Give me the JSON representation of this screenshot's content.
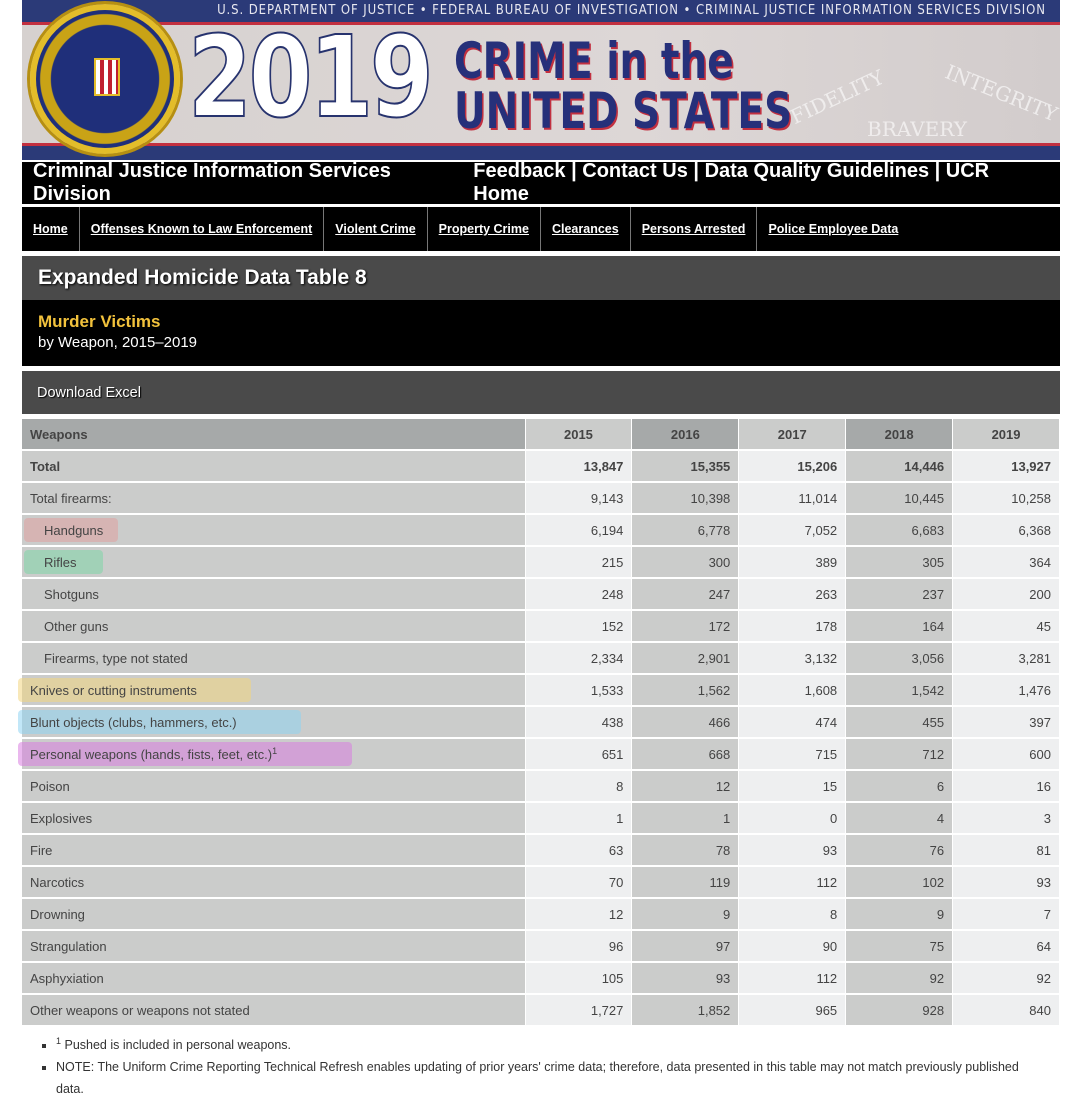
{
  "banner": {
    "topline": "U.S. DEPARTMENT OF JUSTICE • FEDERAL BUREAU OF INVESTIGATION • CRIMINAL JUSTICE INFORMATION SERVICES DIVISION",
    "year": "2019",
    "title_line1": "CRIME in the",
    "title_line2": "UNITED STATES",
    "motto": [
      "FIDELITY",
      "BRAVERY",
      "INTEGRITY"
    ]
  },
  "header": {
    "division": "Criminal Justice Information Services Division",
    "links": [
      "Feedback",
      "Contact Us",
      "Data Quality Guidelines",
      "UCR Home"
    ],
    "separator": " | "
  },
  "nav": [
    "Home",
    "Offenses Known to Law Enforcement",
    "Violent Crime",
    "Property Crime",
    "Clearances",
    "Persons Arrested",
    "Police Employee Data"
  ],
  "page": {
    "title": "Expanded Homicide Data Table 8",
    "subtitle": "Murder Victims",
    "subtitle2": "by Weapon, 2015–2019",
    "download": "Download Excel"
  },
  "table": {
    "headers": [
      "Weapons",
      "2015",
      "2016",
      "2017",
      "2018",
      "2019"
    ],
    "rows": [
      {
        "label": "Total",
        "values": [
          "13,847",
          "15,355",
          "15,206",
          "14,446",
          "13,927"
        ],
        "bold": true
      },
      {
        "label": "Total firearms:",
        "values": [
          "9,143",
          "10,398",
          "11,014",
          "10,445",
          "10,258"
        ]
      },
      {
        "label": "Handguns",
        "values": [
          "6,194",
          "6,778",
          "7,052",
          "6,683",
          "6,368"
        ],
        "indent": true,
        "highlight": "#e0a0a0"
      },
      {
        "label": "Rifles",
        "values": [
          "215",
          "300",
          "389",
          "305",
          "364"
        ],
        "indent": true,
        "highlight": "#7fd6a8"
      },
      {
        "label": "Shotguns",
        "values": [
          "248",
          "247",
          "263",
          "237",
          "200"
        ],
        "indent": true
      },
      {
        "label": "Other guns",
        "values": [
          "152",
          "172",
          "178",
          "164",
          "45"
        ],
        "indent": true
      },
      {
        "label": "Firearms, type not stated",
        "values": [
          "2,334",
          "2,901",
          "3,132",
          "3,056",
          "3,281"
        ],
        "indent": true
      },
      {
        "label": "Knives or cutting instruments",
        "values": [
          "1,533",
          "1,562",
          "1,608",
          "1,542",
          "1,476"
        ],
        "highlight": "#f2d680"
      },
      {
        "label": "Blunt objects (clubs, hammers, etc.)",
        "values": [
          "438",
          "466",
          "474",
          "455",
          "397"
        ],
        "highlight": "#8fd4f2"
      },
      {
        "label": "Personal weapons (hands, fists, feet, etc.)",
        "sup": "1",
        "values": [
          "651",
          "668",
          "715",
          "712",
          "600"
        ],
        "highlight": "#d87ee0"
      },
      {
        "label": "Poison",
        "values": [
          "8",
          "12",
          "15",
          "6",
          "16"
        ]
      },
      {
        "label": "Explosives",
        "values": [
          "1",
          "1",
          "0",
          "4",
          "3"
        ]
      },
      {
        "label": "Fire",
        "values": [
          "63",
          "78",
          "93",
          "76",
          "81"
        ]
      },
      {
        "label": "Narcotics",
        "values": [
          "70",
          "119",
          "112",
          "102",
          "93"
        ]
      },
      {
        "label": "Drowning",
        "values": [
          "12",
          "9",
          "8",
          "9",
          "7"
        ]
      },
      {
        "label": "Strangulation",
        "values": [
          "96",
          "97",
          "90",
          "75",
          "64"
        ]
      },
      {
        "label": "Asphyxiation",
        "values": [
          "105",
          "93",
          "112",
          "92",
          "92"
        ]
      },
      {
        "label": "Other weapons or weapons not stated",
        "values": [
          "1,727",
          "1,852",
          "965",
          "928",
          "840"
        ]
      }
    ]
  },
  "notes": [
    {
      "sup": "1",
      "text": " Pushed is included in personal weapons."
    },
    {
      "text": "NOTE: The Uniform Crime Reporting Technical Refresh enables updating of prior years' crime data; therefore, data presented in this table may not match previously published data."
    }
  ]
}
